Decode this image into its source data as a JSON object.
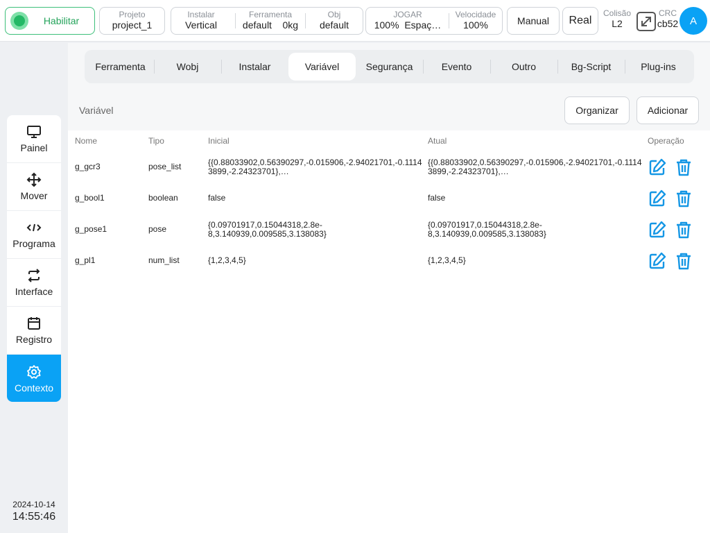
{
  "header": {
    "enable_label": "Habilitar",
    "project": {
      "label": "Projeto",
      "value": "project_1"
    },
    "install": {
      "label": "Instalar",
      "value": "Vertical"
    },
    "tool": {
      "label": "Ferramenta",
      "value": "default",
      "weight": "0kg"
    },
    "obj": {
      "label": "Obj",
      "value": "default"
    },
    "jog": {
      "label": "JOGAR",
      "value": "100%",
      "mode": "Espaç…"
    },
    "speed": {
      "label": "Velocidade",
      "value": "100%"
    },
    "manual_label": "Manual",
    "real_label": "Real",
    "collision": {
      "label": "Colisão",
      "value": "L2"
    },
    "crc": {
      "label": "CRC",
      "value": "cb52"
    },
    "avatar_letter": "A"
  },
  "sidebar": {
    "items": [
      {
        "label": "Painel",
        "icon": "monitor-icon"
      },
      {
        "label": "Mover",
        "icon": "move-arrows-icon"
      },
      {
        "label": "Programa",
        "icon": "code-icon"
      },
      {
        "label": "Interface",
        "icon": "swap-arrows-icon"
      },
      {
        "label": "Registro",
        "icon": "calendar-icon"
      },
      {
        "label": "Contexto",
        "icon": "gear-icon"
      }
    ],
    "date": "2024-10-14",
    "time": "14:55:46"
  },
  "tabs": [
    {
      "label": "Ferramenta"
    },
    {
      "label": "Wobj"
    },
    {
      "label": "Instalar"
    },
    {
      "label": "Variável"
    },
    {
      "label": "Segurança"
    },
    {
      "label": "Evento"
    },
    {
      "label": "Outro"
    },
    {
      "label": "Bg-Script"
    },
    {
      "label": "Plug-ins"
    }
  ],
  "section": {
    "title": "Variável",
    "organize_label": "Organizar",
    "add_label": "Adicionar"
  },
  "table": {
    "columns": [
      "Nome",
      "Tipo",
      "Inicial",
      "Atual",
      "Operação"
    ],
    "rows": [
      {
        "name": "g_gcr3",
        "type": "pose_list",
        "initial_l1": "{{0.88033902,0.56390297,-0.015906,-2.94021701,-0.1114",
        "initial_l2": "3899,-2.24323701},…",
        "current_l1": "{{0.88033902,0.56390297,-0.015906,-2.94021701,-0.1114",
        "current_l2": "3899,-2.24323701},…"
      },
      {
        "name": "g_bool1",
        "type": "boolean",
        "initial_l1": "false",
        "initial_l2": "",
        "current_l1": "false",
        "current_l2": ""
      },
      {
        "name": "g_pose1",
        "type": "pose",
        "initial_l1": "{0.09701917,0.15044318,2.8e-",
        "initial_l2": "8,3.140939,0.009585,3.138083}",
        "current_l1": "{0.09701917,0.15044318,2.8e-",
        "current_l2": "8,3.140939,0.009585,3.138083}"
      },
      {
        "name": "g_pl1",
        "type": "num_list",
        "initial_l1": "{1,2,3,4,5}",
        "initial_l2": "",
        "current_l1": "{1,2,3,4,5}",
        "current_l2": ""
      }
    ]
  },
  "colors": {
    "accent": "#0aa2f5",
    "enable_green": "#23b865",
    "icon_blue": "#1597e5"
  }
}
